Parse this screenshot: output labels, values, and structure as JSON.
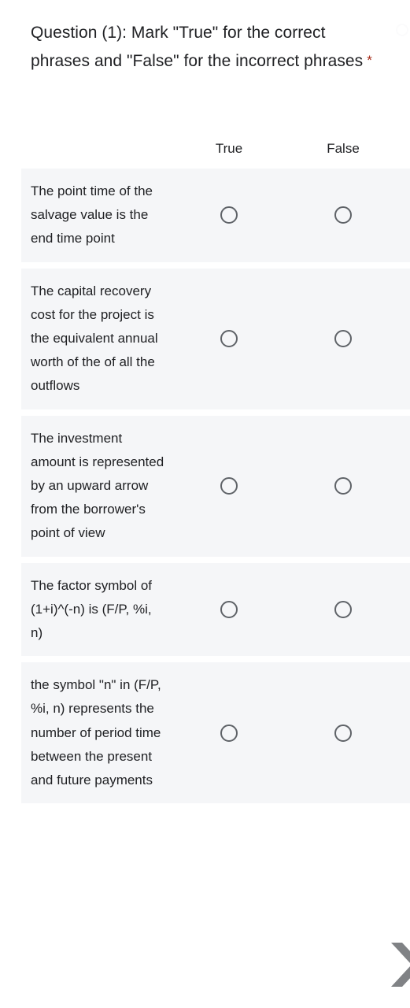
{
  "question": {
    "title": "Question (1): Mark \"True\" for the correct phrases and \"False\" for the incorrect phrases",
    "required_marker": "*"
  },
  "grid": {
    "columns": [
      "True",
      "False"
    ],
    "rows": [
      {
        "label": "The point time of the salvage value is the end time point",
        "selected": null
      },
      {
        "label": "The capital recovery cost for the project is the equivalent annual worth of the of all the outflows",
        "selected": null
      },
      {
        "label": "The investment amount is represented by an upward arrow from the borrower's point of view",
        "selected": null
      },
      {
        "label": "The factor symbol of (1+i)^(-n) is (F/P, %i, n)",
        "selected": null
      },
      {
        "label": "the symbol \"n\" in (F/P, %i, n) represents the number of period time between the present and future payments",
        "selected": null
      }
    ]
  },
  "navigation": {
    "next_icon": "chevron-right-icon"
  },
  "colors": {
    "row_background": "#f5f6f8",
    "page_background": "#ffffff",
    "text": "#202124",
    "required": "#a52714",
    "radio_border": "#5f6368",
    "chevron": "#808285"
  }
}
